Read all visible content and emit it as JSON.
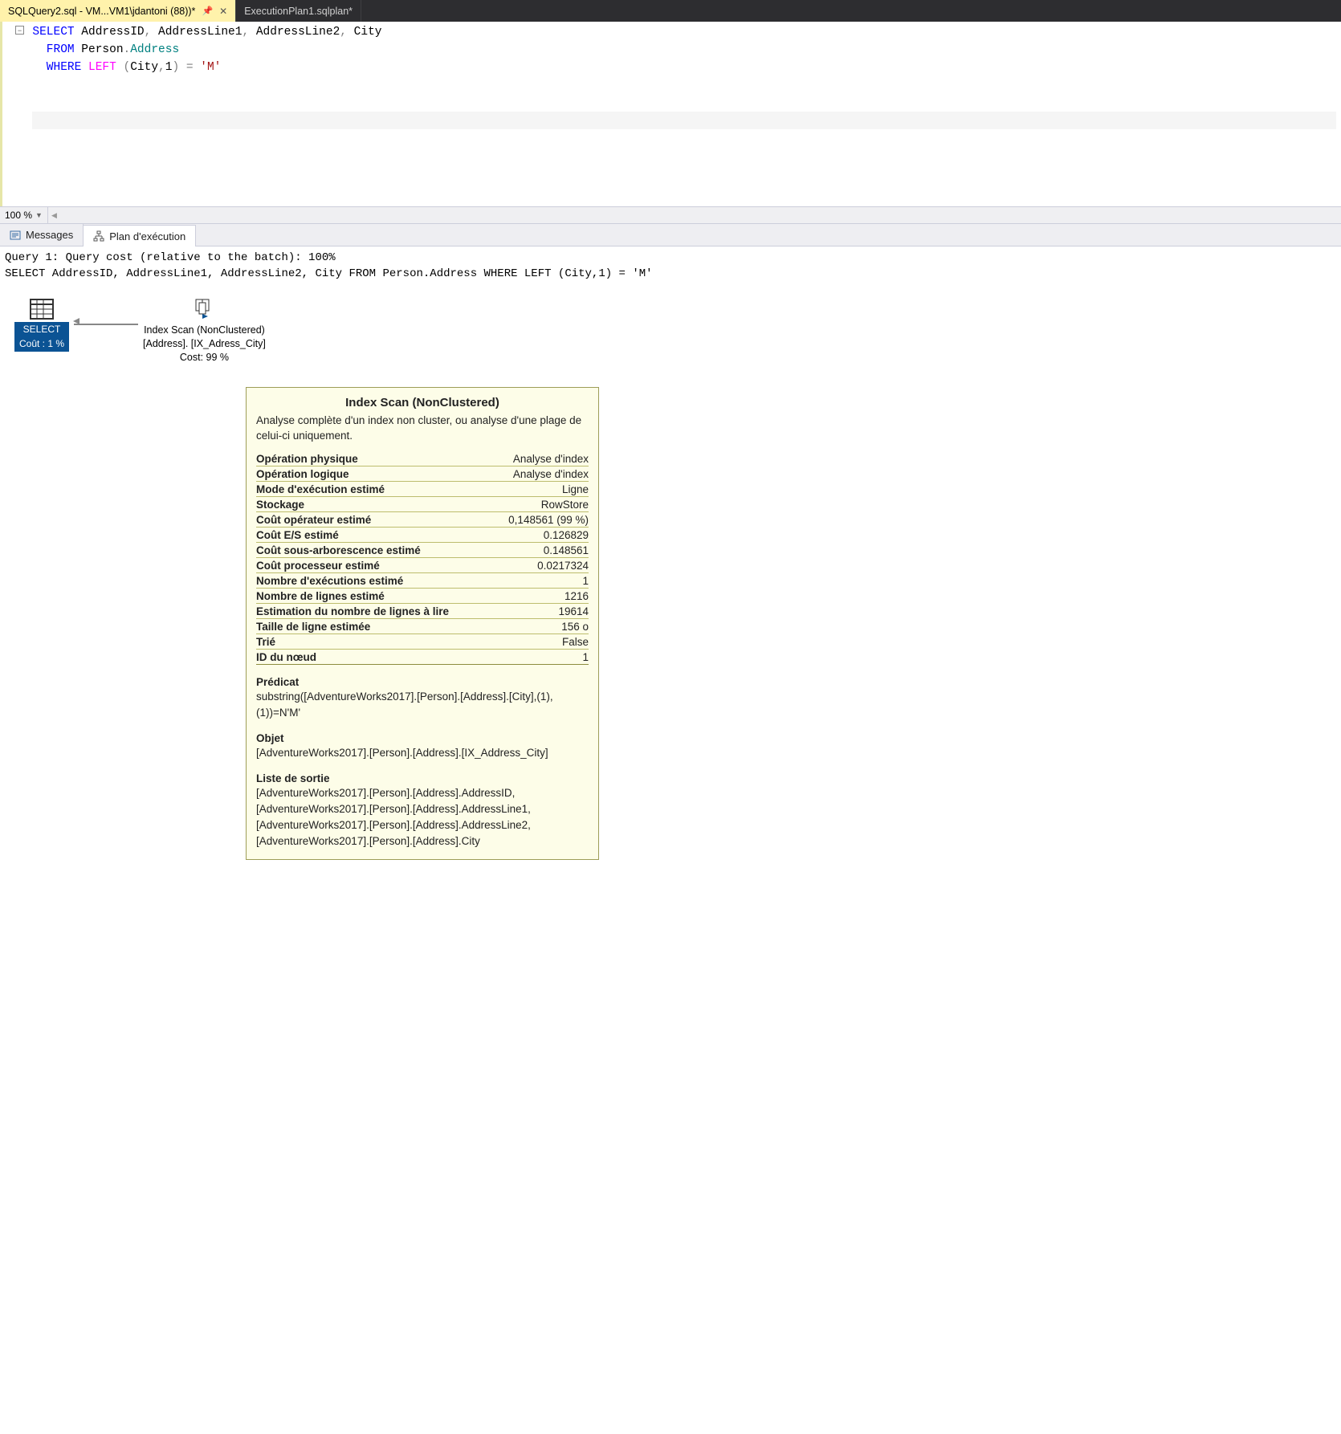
{
  "tabs": {
    "active": "SQLQuery2.sql - VM...VM1\\jdantoni (88))*",
    "other": "ExecutionPlan1.sqlplan*"
  },
  "editor": {
    "l1a": "SELECT",
    "l1b": " AddressID",
    "l1c": ",",
    "l1d": " AddressLine1",
    "l1e": ",",
    "l1f": " AddressLine2",
    "l1g": ",",
    "l1h": " City",
    "l2a": "FROM",
    "l2b": " Person",
    "l2c": ".",
    "l2d": "Address",
    "l3a": "WHERE",
    "l3b": " LEFT",
    "l3c": " (",
    "l3d": "City",
    "l3e": ",",
    "l3f": "1",
    "l3g": ")",
    "l3h": " =",
    "l3i": " 'M'"
  },
  "zoom": "100 %",
  "resultTabs": {
    "messages": "Messages",
    "plan": "Plan d'exécution"
  },
  "plan": {
    "line1": "Query 1: Query cost (relative to the batch): 100%",
    "line2": "SELECT AddressID, AddressLine1, AddressLine2, City FROM Person.Address WHERE LEFT (City,1) = 'M'",
    "select_label": "SELECT",
    "select_cost": "Coût : 1 %",
    "scan_l1": "Index Scan (NonClustered)",
    "scan_l2": "[Address]. [IX_Adress_City]",
    "scan_l3": "Cost: 99 %"
  },
  "tooltip": {
    "title": "Index Scan (NonClustered)",
    "desc": "Analyse complète d'un index non cluster, ou analyse d'une plage de celui-ci uniquement.",
    "rows": [
      {
        "k": "Opération physique",
        "v": "Analyse d'index"
      },
      {
        "k": "Opération logique",
        "v": "Analyse d'index"
      },
      {
        "k": "Mode d'exécution estimé",
        "v": "Ligne"
      },
      {
        "k": "Stockage",
        "v": "RowStore"
      },
      {
        "k": "Coût opérateur estimé",
        "v": "0,148561 (99 %)"
      },
      {
        "k": "Coût E/S estimé",
        "v": "0.126829"
      },
      {
        "k": "Coût sous-arborescence estimé",
        "v": "0.148561"
      },
      {
        "k": "Coût processeur estimé",
        "v": "0.0217324"
      },
      {
        "k": "Nombre d'exécutions estimé",
        "v": "1"
      },
      {
        "k": "Nombre de lignes estimé",
        "v": "1216"
      },
      {
        "k": "Estimation du nombre de lignes à lire",
        "v": "19614"
      },
      {
        "k": "Taille de ligne estimée",
        "v": "156 o"
      },
      {
        "k": "Trié",
        "v": "False"
      },
      {
        "k": "ID du nœud",
        "v": "1"
      }
    ],
    "predicate_h": "Prédicat",
    "predicate_t": "substring([AdventureWorks2017].[Person].[Address].[City],(1),(1))=N'M'",
    "object_h": "Objet",
    "object_t": "[AdventureWorks2017].[Person].[Address].[IX_Address_City]",
    "output_h": "Liste de sortie",
    "output_t": "[AdventureWorks2017].[Person].[Address].AddressID, [AdventureWorks2017].[Person].[Address].AddressLine1, [AdventureWorks2017].[Person].[Address].AddressLine2, [AdventureWorks2017].[Person].[Address].City"
  }
}
